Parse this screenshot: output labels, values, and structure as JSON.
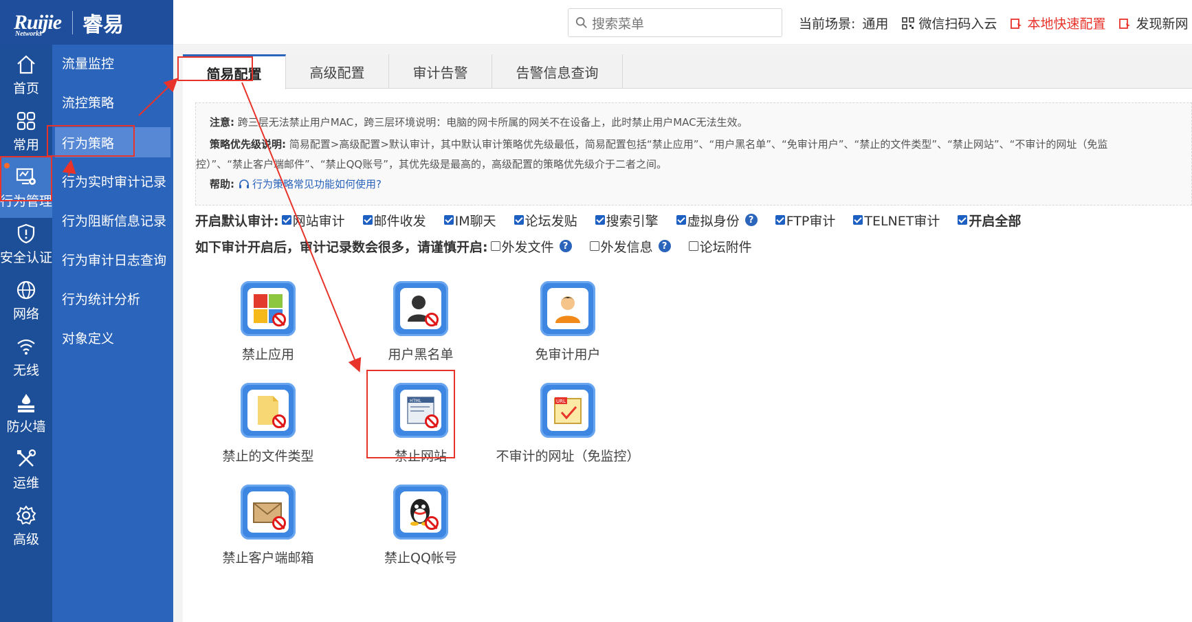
{
  "brand": {
    "name": "Ruijie",
    "sub": "Networks",
    "cn": "睿易"
  },
  "search": {
    "placeholder": "搜索菜单"
  },
  "header": {
    "scene_label": "当前场景:",
    "scene_value": "通用",
    "wechat": "微信扫码入云",
    "quick_config": "本地快速配置",
    "discover": "发现新网"
  },
  "rail": [
    {
      "label": "首页",
      "icon": "home-icon"
    },
    {
      "label": "常用",
      "icon": "grid-icon"
    },
    {
      "label": "行为管理",
      "icon": "monitor-icon",
      "active": true
    },
    {
      "label": "安全认证",
      "icon": "shield-icon"
    },
    {
      "label": "网络",
      "icon": "globe-icon"
    },
    {
      "label": "无线",
      "icon": "wifi-icon"
    },
    {
      "label": "防火墙",
      "icon": "firewall-icon"
    },
    {
      "label": "运维",
      "icon": "tools-icon"
    },
    {
      "label": "高级",
      "icon": "gear-icon"
    }
  ],
  "submenu": [
    {
      "label": "流量监控"
    },
    {
      "label": "流控策略"
    },
    {
      "label": "行为策略",
      "active": true
    },
    {
      "label": "行为实时审计记录"
    },
    {
      "label": "行为阻断信息记录"
    },
    {
      "label": "行为审计日志查询"
    },
    {
      "label": "行为统计分析"
    },
    {
      "label": "对象定义"
    }
  ],
  "tabs": [
    {
      "label": "简易配置",
      "active": true
    },
    {
      "label": "高级配置"
    },
    {
      "label": "审计告警"
    },
    {
      "label": "告警信息查询"
    }
  ],
  "note": {
    "notice_label": "注意:",
    "notice_text": "跨三层无法禁止用户MAC，跨三层环境说明：电脑的网卡所属的网关不在设备上，此时禁止用户MAC无法生效。",
    "priority_label": "策略优先级说明:",
    "priority_text_1": "简易配置>高级配置>默认审计，其中默认审计策略优先级最低，简易配置包括“禁止应用”、“用户黑名单”、“免审计用户”、“禁止的文件类型”、“禁止网站”、“不审计的网址（免监",
    "priority_text_2": "控）”、“禁止客户端邮件”、“禁止QQ账号”，其优先级是最高的，高级配置的策略优先级介于二者之间。",
    "help_label": "帮助:",
    "help_link": "行为策略常见功能如何使用?"
  },
  "default_audit": {
    "label": "开启默认审计:",
    "items": [
      {
        "label": "网站审计",
        "checked": true
      },
      {
        "label": "邮件收发",
        "checked": true
      },
      {
        "label": "IM聊天",
        "checked": true
      },
      {
        "label": "论坛发贴",
        "checked": true
      },
      {
        "label": "搜索引擎",
        "checked": true
      },
      {
        "label": "虚拟身份",
        "checked": true
      },
      {
        "label": "FTP审计",
        "checked": true
      },
      {
        "label": "TELNET审计",
        "checked": true
      },
      {
        "label": "开启全部",
        "checked": true
      }
    ]
  },
  "caution_audit": {
    "label": "如下审计开启后，审计记录数会很多，请谨慎开启:",
    "items": [
      {
        "label": "外发文件",
        "checked": false
      },
      {
        "label": "外发信息",
        "checked": false
      },
      {
        "label": "论坛附件",
        "checked": false
      }
    ]
  },
  "features": [
    {
      "label": "禁止应用",
      "icon": "block-app-icon"
    },
    {
      "label": "用户黑名单",
      "icon": "user-blacklist-icon"
    },
    {
      "label": "免审计用户",
      "icon": "audit-exempt-user-icon"
    },
    {
      "label": "禁止的文件类型",
      "icon": "block-filetype-icon"
    },
    {
      "label": "禁止网站",
      "icon": "block-website-icon"
    },
    {
      "label": "不审计的网址（免监控）",
      "icon": "url-exempt-icon"
    },
    {
      "label": "禁止客户端邮箱",
      "icon": "block-mail-icon"
    },
    {
      "label": "禁止QQ帐号",
      "icon": "block-qq-icon"
    }
  ],
  "colors": {
    "rail": "#1d4f99",
    "submenu": "#2b64bb",
    "accent": "#2b64bb",
    "highlight": "#e8332b"
  }
}
